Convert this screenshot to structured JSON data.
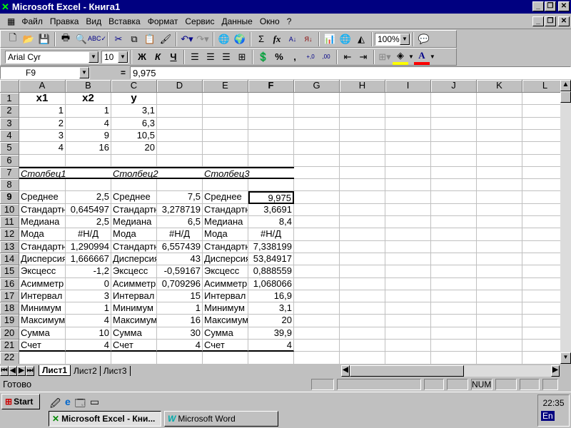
{
  "window": {
    "title": "Microsoft Excel - Книга1"
  },
  "menu": [
    "Файл",
    "Правка",
    "Вид",
    "Вставка",
    "Формат",
    "Сервис",
    "Данные",
    "Окно",
    "?"
  ],
  "toolbar": {
    "zoom": "100%",
    "font": "Arial Cyr",
    "size": "10",
    "bold": "Ж",
    "italic": "К",
    "underline": "Ч",
    "percent": "%",
    "comma": ",",
    "sum": "Σ",
    "fx": "fx"
  },
  "formula": {
    "name_box": "F9",
    "equals": "=",
    "value": "9,975"
  },
  "columns": [
    "A",
    "B",
    "C",
    "D",
    "E",
    "F",
    "G",
    "H",
    "I",
    "J",
    "K",
    "L"
  ],
  "rows": [
    [
      "x1",
      "x2",
      "y",
      "",
      "",
      ""
    ],
    [
      "1",
      "1",
      "3,1",
      "",
      "",
      ""
    ],
    [
      "2",
      "4",
      "6,3",
      "",
      "",
      ""
    ],
    [
      "3",
      "9",
      "10,5",
      "",
      "",
      ""
    ],
    [
      "4",
      "16",
      "20",
      "",
      "",
      ""
    ],
    [
      "",
      "",
      "",
      "",
      "",
      ""
    ],
    [
      "Столбец1",
      "",
      "Столбец2",
      "",
      "Столбец3",
      ""
    ],
    [
      "",
      "",
      "",
      "",
      "",
      ""
    ],
    [
      "Среднее",
      "2,5",
      "Среднее",
      "7,5",
      "Среднее",
      "9,975"
    ],
    [
      "Стандартн",
      "0,645497",
      "Стандартн",
      "3,278719",
      "Стандартн",
      "3,6691"
    ],
    [
      "Медиана",
      "2,5",
      "Медиана",
      "6,5",
      "Медиана",
      "8,4"
    ],
    [
      "Мода",
      "#Н/Д",
      "Мода",
      "#Н/Д",
      "Мода",
      "#Н/Д"
    ],
    [
      "Стандартн",
      "1,290994",
      "Стандартн",
      "6,557439",
      "Стандартн",
      "7,338199"
    ],
    [
      "Дисперсия",
      "1,666667",
      "Дисперсия",
      "43",
      "Дисперсия",
      "53,84917"
    ],
    [
      "Эксцесс",
      "-1,2",
      "Эксцесс",
      "-0,59167",
      "Эксцесс",
      "0,888559"
    ],
    [
      "Асимметр",
      "0",
      "Асимметр",
      "0,709296",
      "Асимметр",
      "1,068066"
    ],
    [
      "Интервал",
      "3",
      "Интервал",
      "15",
      "Интервал",
      "16,9"
    ],
    [
      "Минимум",
      "1",
      "Минимум",
      "1",
      "Минимум",
      "3,1"
    ],
    [
      "Максимум",
      "4",
      "Максимум",
      "16",
      "Максимум",
      "20"
    ],
    [
      "Сумма",
      "10",
      "Сумма",
      "30",
      "Сумма",
      "39,9"
    ],
    [
      "Счет",
      "4",
      "Счет",
      "4",
      "Счет",
      "4"
    ],
    [
      "",
      "",
      "",
      "",
      "",
      ""
    ]
  ],
  "sheets": [
    "Лист1",
    "Лист2",
    "Лист3"
  ],
  "status": {
    "ready": "Готово",
    "num": "NUM"
  },
  "taskbar": {
    "start": "Start",
    "clock": "22:35",
    "lang": "En",
    "tasks": [
      "Microsoft Excel - Кни...",
      "Microsoft Word"
    ]
  }
}
